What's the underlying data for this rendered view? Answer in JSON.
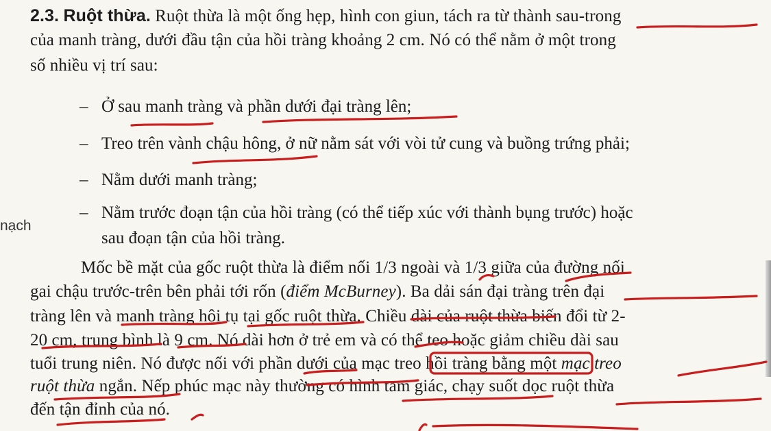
{
  "section": {
    "number": "2.3.",
    "title": "Ruột thừa.",
    "intro": [
      "Ruột thừa là một ống hẹp, hình con giun, tách ra từ thành sau-trong",
      "của manh tràng, dưới đầu tận của hồi tràng khoảng 2 cm. Nó có thể nằm ở một trong",
      "số nhiều vị trí sau:"
    ]
  },
  "positions": [
    "Ở sau manh tràng và phần dưới đại tràng lên;",
    "Treo trên vành chậu hông, ở nữ nằm sát với vòi tử cung và buồng trứng phải;",
    "Nằm dưới manh tràng;",
    "Nằm trước đoạn tận của hồi tràng (có thể tiếp xúc với thành bụng trước) hoặc",
    "sau đoạn tận của hồi tràng."
  ],
  "bullet_dash": "–",
  "margin_note": "nạch",
  "paragraph2": {
    "line1": "Mốc bề mặt của gốc ruột thừa là điểm nối 1/3 ngoài và 1/3 giữa của đường nối",
    "line2_a": "gai chậu trước-trên bên phải tới rốn (",
    "line2_italic": "điểm McBurney",
    "line2_b": "). Ba dải sán đại tràng trên đại",
    "line3": "tràng lên và manh tràng hội tụ tại gốc ruột thừa. Chiều dài của ruột thừa biến đổi từ 2-",
    "line4": "20 cm, trung bình là 9 cm. Nó dài hơn ở trẻ em và có thể teo hoặc giảm chiều dài sau",
    "line5_a": "tuổi trung niên. Nó được nối với phần dưới của mạc treo hồi tràng bằng một ",
    "line5_italic": "mạc treo",
    "line6_italic": "ruột thừa",
    "line6_b": " ngắn. Nếp phúc mạc này thường có hình tam giác, chạy suốt dọc ruột thừa",
    "line7": "đến tận đỉnh của nó."
  },
  "annotation_color": "#c81e1e"
}
